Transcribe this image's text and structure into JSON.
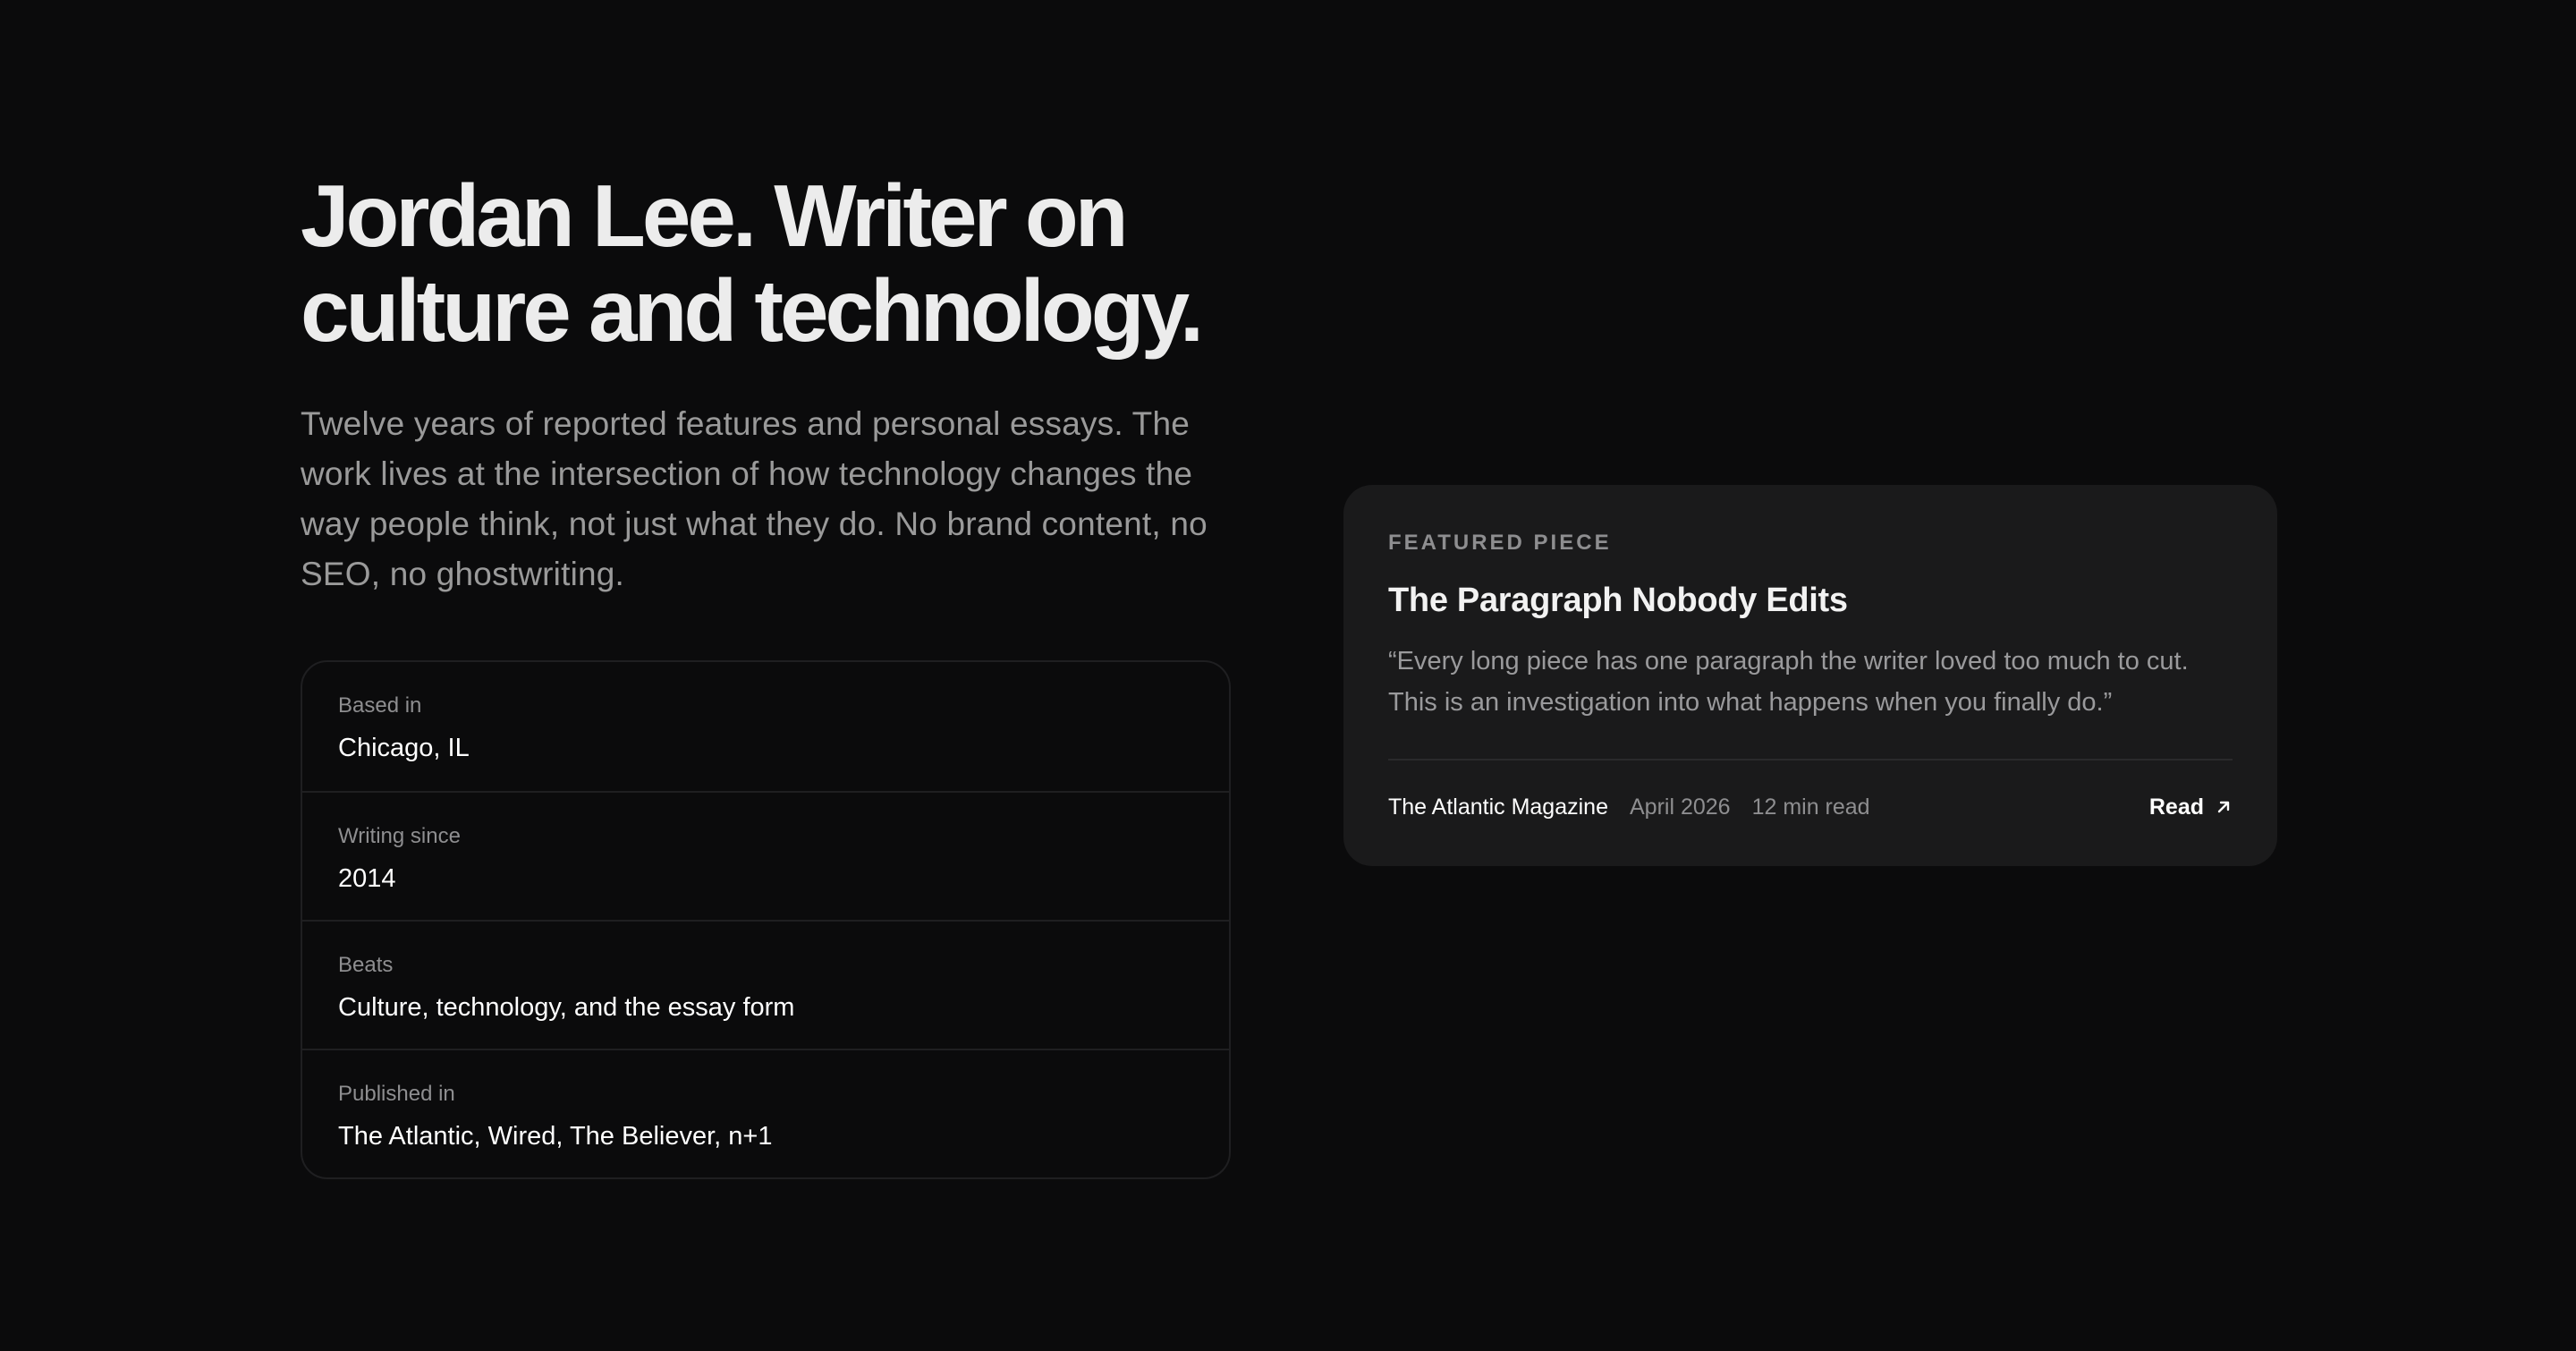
{
  "hero": {
    "headline": "Jordan Lee. Writer on culture and technology.",
    "intro": "Twelve years of reported features and personal essays. The work lives at the intersection of how technology changes the way people think, not just what they do. No brand content, no SEO, no ghostwriting."
  },
  "facts": [
    {
      "label": "Based in",
      "value": "Chicago, IL"
    },
    {
      "label": "Writing since",
      "value": "2014"
    },
    {
      "label": "Beats",
      "value": "Culture, technology, and the essay form"
    },
    {
      "label": "Published in",
      "value": "The Atlantic, Wired, The Believer, n+1"
    }
  ],
  "featured": {
    "eyebrow": "FEATURED PIECE",
    "title": "The Paragraph Nobody Edits",
    "quote": "“Every long piece has one paragraph the writer loved too much to cut. This is an investigation into what happens when you finally do.”",
    "publication": "The Atlantic Magazine",
    "date": "April 2026",
    "read_time": "12 min read",
    "read_label": "Read",
    "read_icon": "arrow-up-right-icon"
  },
  "colors": {
    "background": "#0b0b0c",
    "card": "#1a1a1b",
    "muted_text": "#8e8e90",
    "text": "#ffffff"
  }
}
